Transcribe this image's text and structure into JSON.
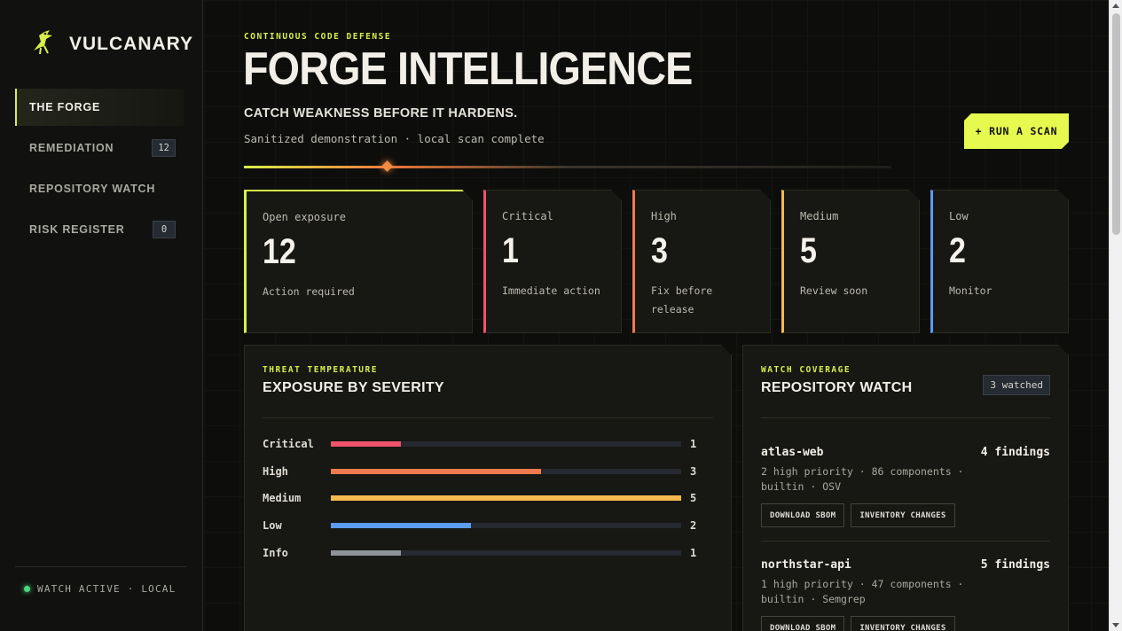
{
  "brand": {
    "name": "VULCANARY",
    "logo_icon": "canary-bird-icon",
    "accent": "#d8ef4a"
  },
  "nav": {
    "items": [
      {
        "label": "THE FORGE",
        "badge": "",
        "active": true
      },
      {
        "label": "REMEDIATION",
        "badge": "12",
        "active": false
      },
      {
        "label": "REPOSITORY WATCH",
        "badge": "",
        "active": false
      },
      {
        "label": "RISK REGISTER",
        "badge": "0",
        "active": false
      }
    ],
    "footer": "WATCH ACTIVE · LOCAL"
  },
  "header": {
    "eyebrow": "CONTINUOUS CODE DEFENSE",
    "title": "FORGE INTELLIGENCE",
    "tagline": "CATCH WEAKNESS BEFORE IT HARDENS.",
    "subline": "Sanitized demonstration · local scan complete",
    "scan_button": "+ RUN A SCAN",
    "scan_progress": 0.22
  },
  "stats": [
    {
      "label": "Open exposure",
      "value": "12",
      "note": "Action required",
      "color": "#d8ef4a"
    },
    {
      "label": "Critical",
      "value": "1",
      "note": "Immediate action",
      "color": "#f0526a"
    },
    {
      "label": "High",
      "value": "3",
      "note": "Fix before release",
      "color": "#f07a4f"
    },
    {
      "label": "Medium",
      "value": "5",
      "note": "Review soon",
      "color": "#f5b94f"
    },
    {
      "label": "Low",
      "value": "2",
      "note": "Monitor",
      "color": "#5b9cf0"
    }
  ],
  "severity_panel": {
    "eyebrow": "THREAT TEMPERATURE",
    "title": "EXPOSURE BY SEVERITY",
    "max": 5,
    "rows": [
      {
        "name": "Critical",
        "count": 1,
        "color": "#f0526a"
      },
      {
        "name": "High",
        "count": 3,
        "color": "#f07a4f"
      },
      {
        "name": "Medium",
        "count": 5,
        "color": "#f5b94f"
      },
      {
        "name": "Low",
        "count": 2,
        "color": "#5b9cf0"
      },
      {
        "name": "Info",
        "count": 1,
        "color": "#8e9299"
      }
    ]
  },
  "watch_panel": {
    "eyebrow": "WATCH COVERAGE",
    "title": "REPOSITORY WATCH",
    "badge": "3 watched",
    "repos": [
      {
        "name": "atlas-web",
        "findings": "4 findings",
        "meta": "2 high priority · 86 components · builtin · OSV",
        "download": "DOWNLOAD SBOM",
        "inventory": "INVENTORY CHANGES"
      },
      {
        "name": "northstar-api",
        "findings": "5 findings",
        "meta": "1 high priority · 47 components · builtin · Semgrep",
        "download": "DOWNLOAD SBOM",
        "inventory": "INVENTORY CHANGES"
      }
    ]
  }
}
